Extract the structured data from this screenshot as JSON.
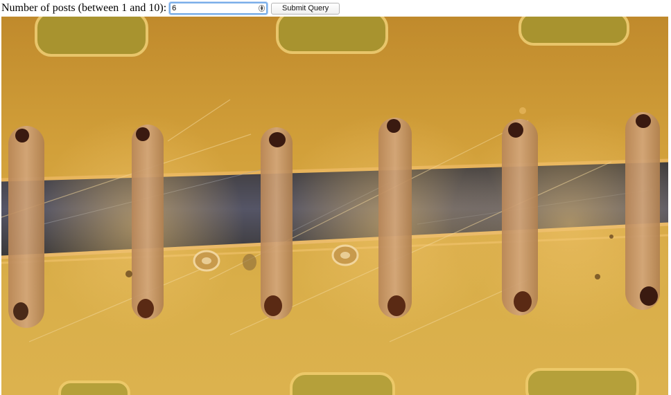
{
  "form": {
    "label": "Number of posts (between 1 and 10):",
    "input_value": "6",
    "submit_label": "Submit Query"
  },
  "photo": {
    "post_count": 6,
    "colors": {
      "amber": "#c8952a",
      "light_amber": "#e1bb5a",
      "dark_channel": "#3a3a40",
      "post": "#c99a6a",
      "pit": "#3a1a10"
    }
  }
}
